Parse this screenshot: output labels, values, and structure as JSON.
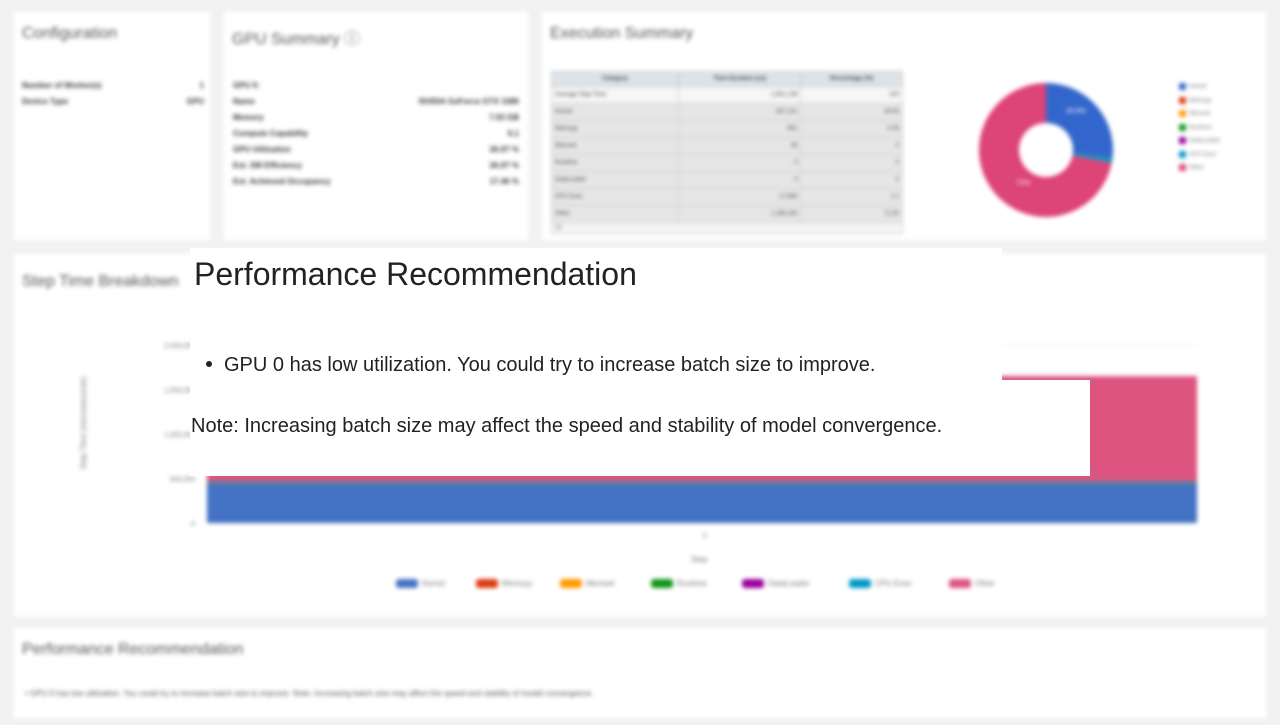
{
  "configuration": {
    "title": "Configuration",
    "rows": [
      {
        "label": "Number of Worker(s)",
        "value": "1"
      },
      {
        "label": "Device Type",
        "value": "GPU"
      }
    ]
  },
  "gpu_summary": {
    "title": "GPU Summary ⓘ",
    "rows": [
      {
        "label": "GPU 0:",
        "value": ""
      },
      {
        "label": "Name",
        "value": "NVIDIA GeForce GTX 1080"
      },
      {
        "label": "Memory",
        "value": "7.93 GB"
      },
      {
        "label": "Compute Capability",
        "value": "6.1"
      },
      {
        "label": "GPU Utilization",
        "value": "26.97 %"
      },
      {
        "label": "Est. SM Efficiency",
        "value": "26.97 %"
      },
      {
        "label": "Est. Achieved Occupancy",
        "value": "17.46 %"
      }
    ]
  },
  "execution_summary": {
    "title": "Execution Summary",
    "columns": [
      "Category",
      "Time Duration (us)",
      "Percentage (%)"
    ],
    "rows": [
      [
        "Average Step Time",
        "1,651,139",
        "100"
      ],
      [
        "Kernel",
        "447,101",
        "26.93"
      ],
      [
        "Memcpy",
        "851",
        "0.05"
      ],
      [
        "Memset",
        "45",
        "0"
      ],
      [
        "Runtime",
        "0",
        "0"
      ],
      [
        "DataLoader",
        "0",
        "0"
      ],
      [
        "CPU Exec",
        "17,960",
        "1.1"
      ],
      [
        "Other",
        "1,185,183",
        "71.92"
      ]
    ],
    "pagination": "1/1",
    "donut": {
      "labels": [
        "Kernel",
        "Memcpy",
        "Memset",
        "Runtime",
        "DataLoader",
        "CPU Exec",
        "Other"
      ],
      "values": [
        26.93,
        0.05,
        0,
        0,
        0,
        1.1,
        71.92
      ],
      "colors": [
        "#3366cc",
        "#dc3912",
        "#ff9900",
        "#109618",
        "#990099",
        "#0099c6",
        "#dd4477"
      ],
      "slice_labels": [
        "26.9%",
        "72%"
      ]
    }
  },
  "step_time": {
    "title": "Step Time Breakdown",
    "ylabel": "Step Time (microseconds)",
    "xlabel": "Step",
    "yticks": [
      "2,000,000",
      "1,500,000",
      "1,000,000",
      "500,000",
      "0"
    ],
    "xtick": "0",
    "chart_data": {
      "type": "area",
      "categories": [
        "0"
      ],
      "ylim": [
        0,
        2000000
      ],
      "series": [
        {
          "name": "Kernel",
          "values": [
            447101
          ],
          "color": "#4472c4"
        },
        {
          "name": "Memcpy",
          "values": [
            851
          ],
          "color": "#dc3912"
        },
        {
          "name": "Memset",
          "values": [
            45
          ],
          "color": "#ff9900"
        },
        {
          "name": "Runtime",
          "values": [
            0
          ],
          "color": "#109618"
        },
        {
          "name": "DataLoader",
          "values": [
            0
          ],
          "color": "#990099"
        },
        {
          "name": "CPU Exec",
          "values": [
            17960
          ],
          "color": "#0099c6"
        },
        {
          "name": "Other",
          "values": [
            1185183
          ],
          "color": "#dd5480"
        }
      ]
    }
  },
  "recommendation_card": {
    "title": "Performance Recommendation",
    "text": "• GPU 0 has low utilization. You could try to increase batch size to improve. Note: Increasing batch size may affect the speed and stability of model convergence."
  },
  "overlay": {
    "title": "Performance Recommendation",
    "bullet": "GPU 0 has low utilization. You could try to increase batch size to improve.",
    "note": "Note: Increasing batch size may affect the speed and stability of model convergence."
  }
}
